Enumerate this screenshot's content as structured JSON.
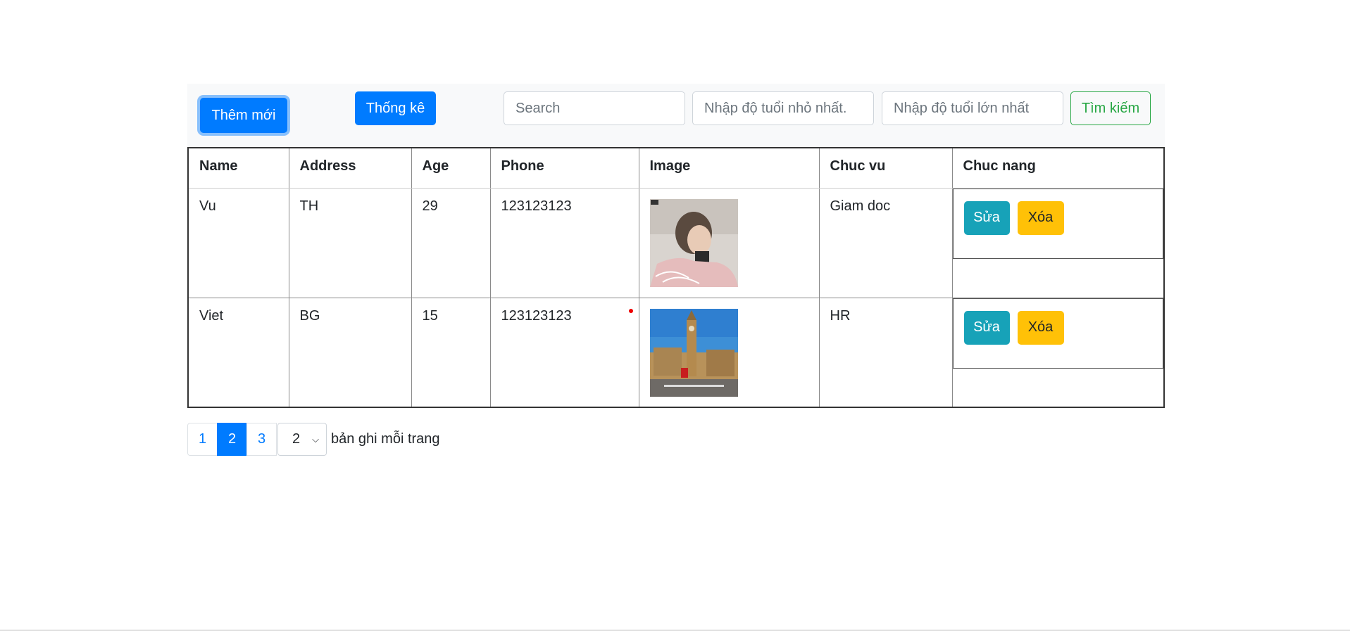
{
  "toolbar": {
    "add_label": "Thêm mới",
    "stats_label": "Thống kê",
    "search_placeholder": "Search",
    "min_age_placeholder": "Nhập độ tuổi nhỏ nhất.",
    "max_age_placeholder": "Nhập độ tuổi lớn nhất",
    "find_label": "Tìm kiếm"
  },
  "table": {
    "headers": [
      "Name",
      "Address",
      "Age",
      "Phone",
      "Image",
      "Chuc vu",
      "Chuc nang"
    ],
    "rows": [
      {
        "name": "Vu",
        "address": "TH",
        "age": "29",
        "phone": "123123123",
        "position": "Giam doc",
        "edit_label": "Sửa",
        "delete_label": "Xóa"
      },
      {
        "name": "Viet",
        "address": "BG",
        "age": "15",
        "phone": "123123123",
        "position": "HR",
        "edit_label": "Sửa",
        "delete_label": "Xóa"
      }
    ]
  },
  "pagination": {
    "pages": [
      "1",
      "2",
      "3"
    ],
    "active_page": "2",
    "per_page_value": "2",
    "per_page_label": "bản ghi mỗi trang"
  },
  "colors": {
    "primary": "#007bff",
    "info": "#17a2b8",
    "warning": "#ffc107",
    "success": "#28a745"
  }
}
